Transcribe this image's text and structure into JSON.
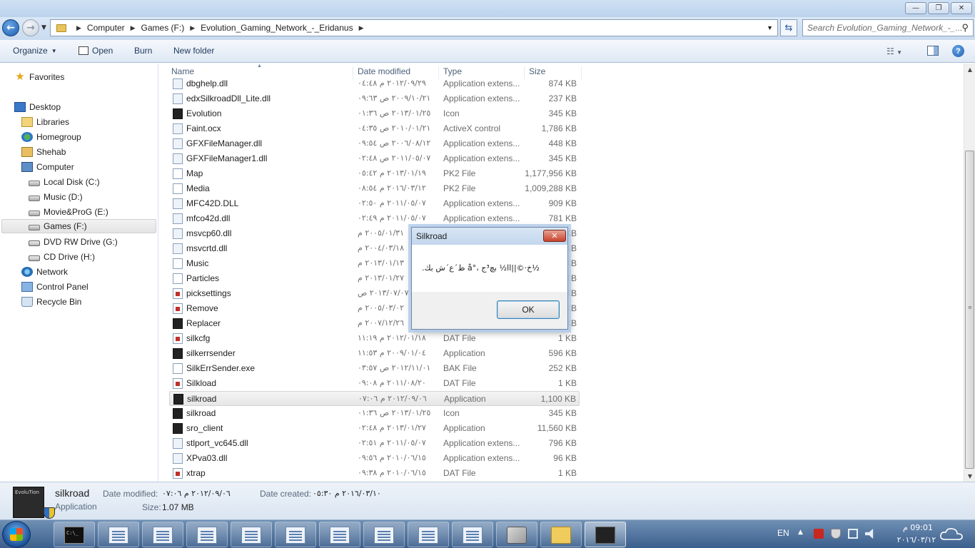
{
  "window": {
    "minimize_glyph": "—",
    "maximize_glyph": "❐",
    "close_glyph": "✕"
  },
  "address": {
    "breadcrumbs": [
      "Computer",
      "Games (F:)",
      "Evolution_Gaming_Network_-_Eridanus"
    ],
    "search_placeholder": "Search Evolution_Gaming_Network_-_..."
  },
  "toolbar": {
    "organize_label": "Organize",
    "open_label": "Open",
    "burn_label": "Burn",
    "newfolder_label": "New folder"
  },
  "nav": {
    "favorites": "Favorites",
    "desktop": "Desktop",
    "libraries": "Libraries",
    "homegroup": "Homegroup",
    "user": "Shehab",
    "computer": "Computer",
    "drive_c": "Local Disk (C:)",
    "drive_d": "Music (D:)",
    "drive_e": "Movie&ProG (E:)",
    "drive_f": "Games (F:)",
    "drive_g": "DVD RW Drive (G:)",
    "drive_h": "CD Drive (H:)",
    "network": "Network",
    "control_panel": "Control Panel",
    "recycle_bin": "Recycle Bin"
  },
  "columns": {
    "name": "Name",
    "date": "Date modified",
    "type": "Type",
    "size": "Size"
  },
  "files": [
    {
      "name": "dbghelp.dll",
      "date": "٢٠١٢/٠٩/٢٩ م ٠٤:٤٨",
      "type": "Application extens...",
      "size": "874 KB",
      "icon": "dll-icon"
    },
    {
      "name": "edxSilkroadDll_Lite.dll",
      "date": "٢٠٠٩/١٠/٢١ ص ٠٩:٦٣",
      "type": "Application extens...",
      "size": "237 KB",
      "icon": "dll-icon"
    },
    {
      "name": "Evolution",
      "date": "٢٠١٣/٠١/٢٥ ص ٠١:٣٦",
      "type": "Icon",
      "size": "345 KB",
      "icon": "game-icon"
    },
    {
      "name": "Faint.ocx",
      "date": "٢٠١٠/٠١/٢١ ص ٠٤:٣٥",
      "type": "ActiveX control",
      "size": "1,786 KB",
      "icon": "dll-icon"
    },
    {
      "name": "GFXFileManager.dll",
      "date": "٢٠٠٦/٠٨/١٢ ص ٠٩:٥٤",
      "type": "Application extens...",
      "size": "448 KB",
      "icon": "dll-icon"
    },
    {
      "name": "GFXFileManager1.dll",
      "date": "٢٠١١/٠٥/٠٧ ص ٠٢:٤٨",
      "type": "Application extens...",
      "size": "345 KB",
      "icon": "dll-icon"
    },
    {
      "name": "Map",
      "date": "٢٠١٣/٠١/١٩ م ٠٥:٤٢",
      "type": "PK2 File",
      "size": "1,177,956 KB",
      "icon": "file-icon"
    },
    {
      "name": "Media",
      "date": "٢٠١٦/٠٣/١٢ م ٠٨:٥٤",
      "type": "PK2 File",
      "size": "1,009,288 KB",
      "icon": "file-icon"
    },
    {
      "name": "MFC42D.DLL",
      "date": "٢٠١١/٠٥/٠٧ م ٠٢:٥٠",
      "type": "Application extens...",
      "size": "909 KB",
      "icon": "dll-icon"
    },
    {
      "name": "mfco42d.dll",
      "date": "٢٠١١/٠٥/٠٧ م ٠٢:٤٩",
      "type": "Application extens...",
      "size": "781 KB",
      "icon": "dll-icon"
    },
    {
      "name": "msvcp60.dll",
      "date": "٢٠٠٥/٠١/٣١ م",
      "type": "",
      "size": "KB",
      "icon": "dll-icon"
    },
    {
      "name": "msvcrtd.dll",
      "date": "٢٠٠٤/٠٣/١٨ م",
      "type": "",
      "size": "KB",
      "icon": "dll-icon"
    },
    {
      "name": "Music",
      "date": "٢٠١٣/٠١/١٣ م",
      "type": "",
      "size": "KB",
      "icon": "file-icon"
    },
    {
      "name": "Particles",
      "date": "٢٠١٣/٠١/٢٧ م",
      "type": "",
      "size": "KB",
      "icon": "file-icon"
    },
    {
      "name": "picksettings",
      "date": "٢٠١٣/٠٧/٠٧ ص",
      "type": "",
      "size": "KB",
      "icon": "dat-icon"
    },
    {
      "name": "Remove",
      "date": "٢٠٠٥/٠٣/٠٢ م",
      "type": "",
      "size": "KB",
      "icon": "dat-icon"
    },
    {
      "name": "Replacer",
      "date": "٢٠٠٧/١٢/٢٦ م",
      "type": "",
      "size": "KB",
      "icon": "game-icon"
    },
    {
      "name": "silkcfg",
      "date": "٢٠١٢/٠١/١٨ م ١١:١٩",
      "type": "DAT File",
      "size": "1 KB",
      "icon": "dat-icon"
    },
    {
      "name": "silkerrsender",
      "date": "٢٠٠٩/٠١/٠٤ م ١١:٥٣",
      "type": "Application",
      "size": "596 KB",
      "icon": "game-icon"
    },
    {
      "name": "SilkErrSender.exe",
      "date": "٢٠١٢/١١/٠١ ص ٠٣:٥٧",
      "type": "BAK File",
      "size": "252 KB",
      "icon": "file-icon"
    },
    {
      "name": "Silkload",
      "date": "٢٠١١/٠٨/٢٠ م ٠٩:٠٨",
      "type": "DAT File",
      "size": "1 KB",
      "icon": "dat-icon"
    },
    {
      "name": "silkroad",
      "date": "٢٠١٢/٠٩/٠٦ م ٠٧:٠٦",
      "type": "Application",
      "size": "1,100 KB",
      "icon": "game-icon"
    },
    {
      "name": "silkroad",
      "date": "٢٠١٣/٠١/٢٥ ص ٠١:٣٦",
      "type": "Icon",
      "size": "345 KB",
      "icon": "game-icon"
    },
    {
      "name": "sro_client",
      "date": "٢٠١٣/٠١/٢٧ م ٠٢:٤٨",
      "type": "Application",
      "size": "11,560 KB",
      "icon": "game-icon"
    },
    {
      "name": "stlport_vc645.dll",
      "date": "٢٠١١/٠٥/٠٧ م ٠٢:٥١",
      "type": "Application extens...",
      "size": "796 KB",
      "icon": "dll-icon"
    },
    {
      "name": "XPva03.dll",
      "date": "٢٠١٠/٠٦/١٥ م ٠٩:٥٦",
      "type": "Application extens...",
      "size": "96 KB",
      "icon": "dll-icon"
    },
    {
      "name": "xtrap",
      "date": "٢٠١٠/٠٦/١٥ م ٠٩:٣٨",
      "type": "DAT File",
      "size": "1 KB",
      "icon": "dat-icon"
    }
  ],
  "selected_index": 21,
  "details": {
    "name": "silkroad",
    "kind": "Application",
    "modified_label": "Date modified:",
    "modified_value": "٢٠١٢/٠٩/٠٦ م ٠٧:٠٦",
    "created_label": "Date created:",
    "created_value": "٢٠١٦/٠٣/١٠ م ٠٥:٣٠",
    "size_label": "Size:",
    "size_value": "1.07 MB",
    "thumb_text": "EvoluTion"
  },
  "dialog": {
    "title": "Silkroad",
    "close_glyph": "✕",
    "message": "½خ·©||اا½ بچ³ج ،°å ظ´ع´ش بك.",
    "ok_label": "OK"
  },
  "taskbar": {
    "language": "EN",
    "time": "09:01 م",
    "date": "٢٠١٦/٠٣/١٢"
  },
  "colors": {
    "accent": "#3c7fb1",
    "selection": "#e6e6e6",
    "taskbar": "#3b5f8c",
    "dialog_close": "#c7432e"
  }
}
